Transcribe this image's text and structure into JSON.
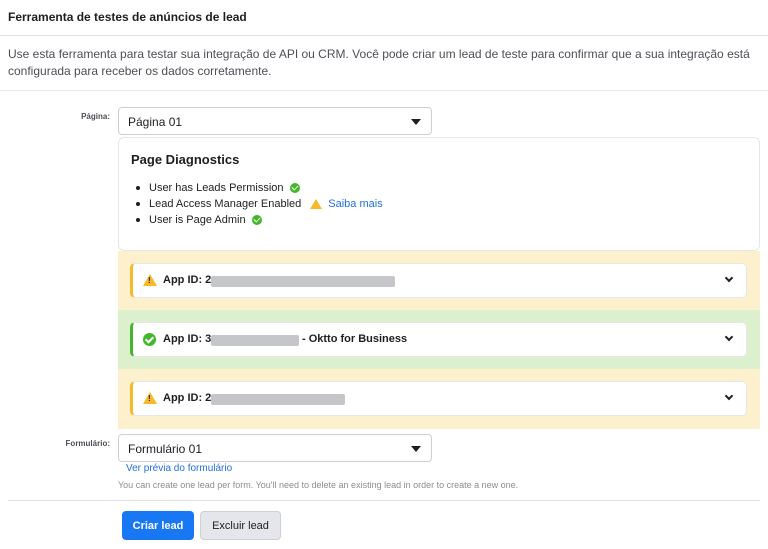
{
  "header": {
    "title": "Ferramenta de testes de anúncios de lead"
  },
  "description": "Use esta ferramenta para testar sua integração de API ou CRM. Você pode criar um lead de teste para confirmar que a sua integração está configurada para receber os dados corretamente.",
  "page_select": {
    "label": "Página:",
    "value": "Página 01"
  },
  "diagnostics": {
    "title": "Page Diagnostics",
    "items": [
      {
        "text": "User has Leads Permission",
        "status": "ok"
      },
      {
        "text": "Lead Access Manager Enabled",
        "status": "warning",
        "link": "Saiba mais"
      },
      {
        "text": "User is Page Admin",
        "status": "ok"
      }
    ]
  },
  "apps": [
    {
      "prefix": "App ID: 2",
      "suffix": "",
      "status": "warning"
    },
    {
      "prefix": "App ID: 3",
      "suffix": "- Oktto for Business",
      "status": "ok"
    },
    {
      "prefix": "App ID: 2",
      "suffix": "",
      "status": "warning"
    }
  ],
  "form_select": {
    "label": "Formulário:",
    "value": "Formulário 01"
  },
  "preview_link": "Ver prévia do formulário",
  "hint": "You can create one lead per form. You'll need to delete an existing lead in order to create a new one.",
  "buttons": {
    "create": "Criar lead",
    "delete": "Excluir lead"
  },
  "colors": {
    "warning": "#f7b928",
    "ok": "#42b72a",
    "primary": "#1877f2",
    "link": "#216fdb"
  }
}
